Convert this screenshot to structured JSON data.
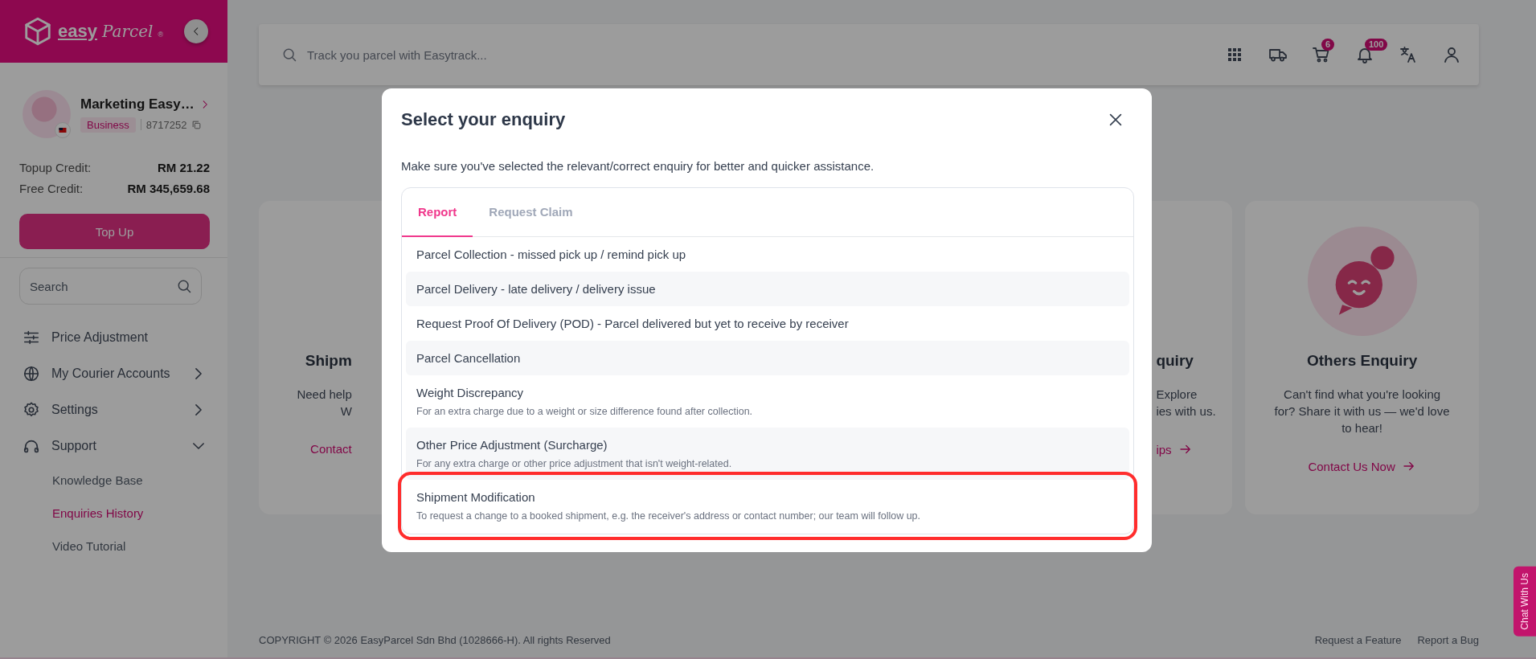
{
  "sidebar": {
    "logo": {
      "part_1": "easy",
      "part_2": "Parcel",
      "mark": "®"
    },
    "profile": {
      "name": "Marketing Easy…",
      "badge": "Business",
      "account_id": "8717252"
    },
    "credits": [
      {
        "label": "Topup Credit:",
        "value": "RM 21.22"
      },
      {
        "label": "Free Credit:",
        "value": "RM 345,659.68"
      }
    ],
    "top_up_button": "Top Up",
    "search": {
      "placeholder": "Search"
    },
    "nav": [
      {
        "label": "Price Adjustment",
        "kind": "link",
        "expanded": false
      },
      {
        "label": "My Courier Accounts",
        "kind": "group",
        "expanded": false
      },
      {
        "label": "Settings",
        "kind": "group",
        "expanded": false
      },
      {
        "label": "Support",
        "kind": "group",
        "expanded": true,
        "children": [
          {
            "label": "Knowledge Base",
            "selected": false
          },
          {
            "label": "Enquiries History",
            "selected": true
          },
          {
            "label": "Video Tutorial",
            "selected": false
          }
        ]
      }
    ]
  },
  "top_bar": {
    "search": {
      "placeholder": "Track you parcel with Easytrack..."
    },
    "icons": [
      {
        "kind": "apps"
      },
      {
        "kind": "truck"
      },
      {
        "kind": "cart",
        "badge": "6"
      },
      {
        "kind": "bell",
        "badge": "100"
      },
      {
        "kind": "translate"
      },
      {
        "kind": "user"
      }
    ]
  },
  "cards": [
    {
      "kind": "left-edge",
      "title": "Shipm",
      "lines": [
        "Need help",
        "W"
      ],
      "link": "Contact"
    },
    {
      "kind": "right-edge",
      "title": "quiry",
      "lines": [
        "Explore",
        "ies with us."
      ],
      "link": "ips"
    },
    {
      "kind": "full",
      "title": "Others Enquiry",
      "lines": [
        "Can't find what you're looking",
        "for? Share it with us — we'd love",
        "to hear!"
      ],
      "link": "Contact Us Now"
    }
  ],
  "modal": {
    "title": "Select your enquiry",
    "description": "Make sure you've selected the relevant/correct enquiry for better and quicker assistance.",
    "tabs": [
      {
        "label": "Report",
        "selected": true
      },
      {
        "label": "Request Claim",
        "selected": false
      }
    ],
    "items": [
      {
        "title": "Parcel Collection - missed pick up / remind pick up",
        "highlighted": false
      },
      {
        "title": "Parcel Delivery - late delivery / delivery issue",
        "highlighted": false
      },
      {
        "title": "Request Proof Of Delivery (POD) - Parcel delivered but yet to receive by receiver",
        "highlighted": false
      },
      {
        "title": "Parcel Cancellation",
        "highlighted": false
      },
      {
        "title": "Weight Discrepancy",
        "description": "For an extra charge due to a weight or size difference found after collection.",
        "highlighted": false
      },
      {
        "title": "Other Price Adjustment (Surcharge)",
        "description": "For any extra charge or other price adjustment that isn't weight-related.",
        "highlighted": false
      },
      {
        "title": "Shipment Modification",
        "description": "To request a change to a booked shipment, e.g. the receiver's address or contact number; our team will follow up.",
        "highlighted": true
      }
    ]
  },
  "footer": {
    "copyright": "COPYRIGHT © 2026 EasyParcel Sdn Bhd (1028666-H). All rights Reserved",
    "links": [
      "Request a Feature",
      "Report a Bug"
    ]
  },
  "chat_tab": "Chat With Us"
}
